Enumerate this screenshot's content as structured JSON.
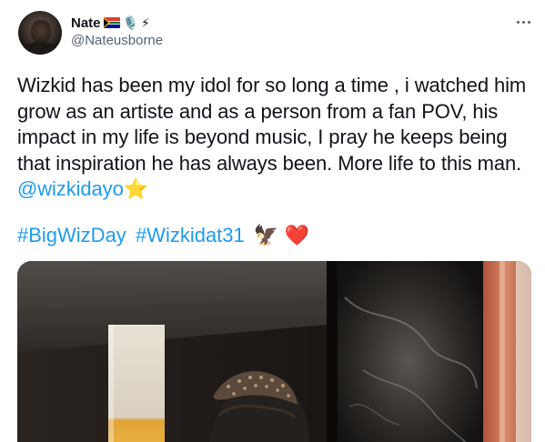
{
  "author": {
    "display_name": "Nate",
    "badges": [
      "south-africa-flag-icon",
      "microphone-icon",
      "lightning-icon"
    ],
    "handle": "@Nateusborne"
  },
  "tweet": {
    "text": "Wizkid has been my idol for so long a time , i watched him grow as an artiste and as a person from a fan POV, his impact in my life is beyond music, I pray he keeps being that inspiration he has always been. More life to this man.",
    "mention": "@wizkidayo",
    "mention_emoji": "⭐",
    "hashtags": [
      "#BigWizDay",
      "#Wizkidat31"
    ],
    "trailing_emojis": [
      "🦅",
      "❤️"
    ]
  },
  "colors": {
    "link": "#1d9bf0",
    "text": "#0f1419",
    "secondary": "#536471"
  }
}
